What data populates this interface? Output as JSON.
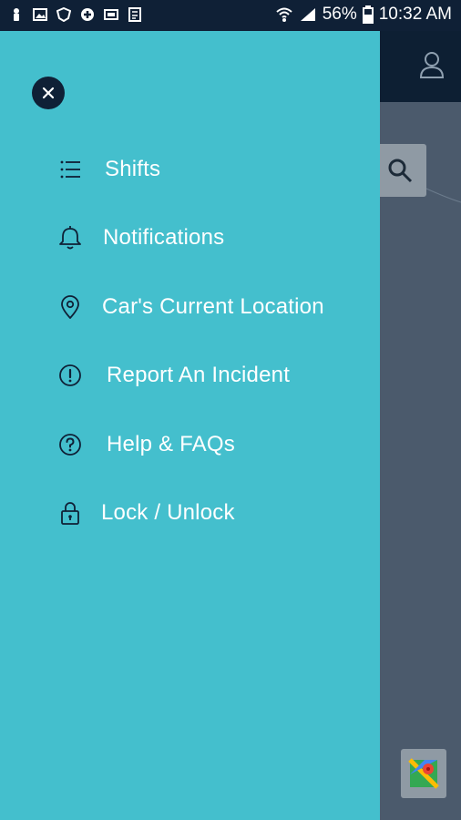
{
  "status_bar": {
    "battery": "56%",
    "time": "10:32 AM"
  },
  "drawer": {
    "menu": [
      {
        "label": "Shifts",
        "icon": "list-icon"
      },
      {
        "label": "Notifications",
        "icon": "bell-icon"
      },
      {
        "label": "Car's Current Location",
        "icon": "location-pin-icon"
      },
      {
        "label": "Report An Incident",
        "icon": "alert-circle-icon"
      },
      {
        "label": "Help & FAQs",
        "icon": "help-circle-icon"
      },
      {
        "label": "Lock / Unlock",
        "icon": "padlock-icon"
      }
    ]
  },
  "colors": {
    "drawer_bg": "#44bfcd",
    "header_bg": "#0f2036",
    "icon_color": "#0f2036",
    "text_color": "#ffffff"
  }
}
